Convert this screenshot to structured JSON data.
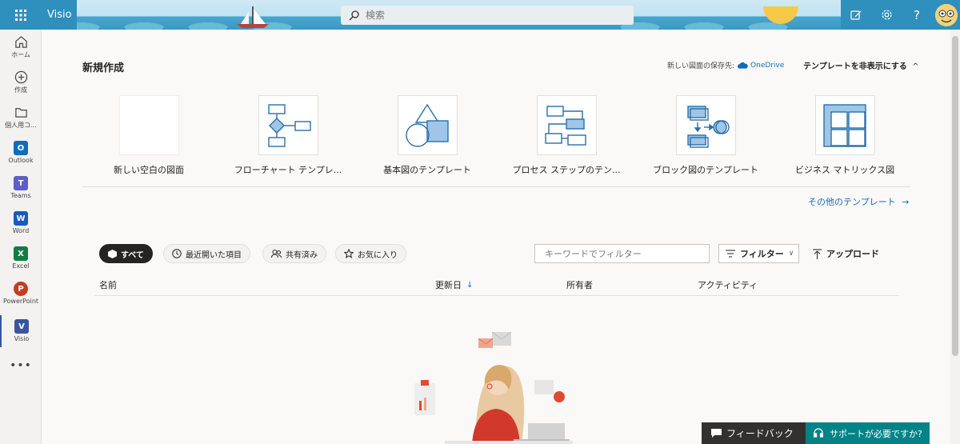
{
  "header": {
    "app_name": "Visio",
    "search_placeholder": "検索"
  },
  "rail": [
    {
      "label": "ホーム"
    },
    {
      "label": "作成"
    },
    {
      "label": "個人用コ..."
    },
    {
      "label": "Outlook",
      "letter": "O",
      "color": "#0f6cbd"
    },
    {
      "label": "Teams",
      "letter": "T",
      "color": "#5b5fc7"
    },
    {
      "label": "Word",
      "letter": "W",
      "color": "#185abd"
    },
    {
      "label": "Excel",
      "letter": "X",
      "color": "#107c41"
    },
    {
      "label": "PowerPoint",
      "letter": "P",
      "color": "#c43e1c"
    },
    {
      "label": "Visio",
      "letter": "V",
      "color": "#3955a3"
    }
  ],
  "new_section": {
    "title": "新規作成",
    "save_label": "新しい図面の保存先:",
    "save_target": "OneDrive",
    "hide_templates": "テンプレートを非表示にする",
    "more_templates": "その他のテンプレート"
  },
  "templates": [
    {
      "name": "新しい空白の図面"
    },
    {
      "name": "フローチャート テンプレ..."
    },
    {
      "name": "基本図のテンプレート"
    },
    {
      "name": "プロセス ステップのテン..."
    },
    {
      "name": "ブロック図のテンプレート"
    },
    {
      "name": "ビジネス マトリックス図"
    }
  ],
  "files": {
    "tabs": [
      {
        "label": "すべて"
      },
      {
        "label": "最近開いた項目"
      },
      {
        "label": "共有済み"
      },
      {
        "label": "お気に入り"
      }
    ],
    "keyword_placeholder": "キーワードでフィルター",
    "filter_label": "フィルター",
    "upload_label": "アップロード",
    "columns": [
      "名前",
      "更新日",
      "所有者",
      "アクティビティ"
    ]
  },
  "footer": {
    "feedback": "フィードバック",
    "support": "サポートが必要ですか?"
  },
  "colors": {
    "accent": "#0f6cbd",
    "visio_blue": "#3955a3",
    "shape_fill": "#9fc6e7",
    "shape_stroke": "#2a6fa8"
  }
}
